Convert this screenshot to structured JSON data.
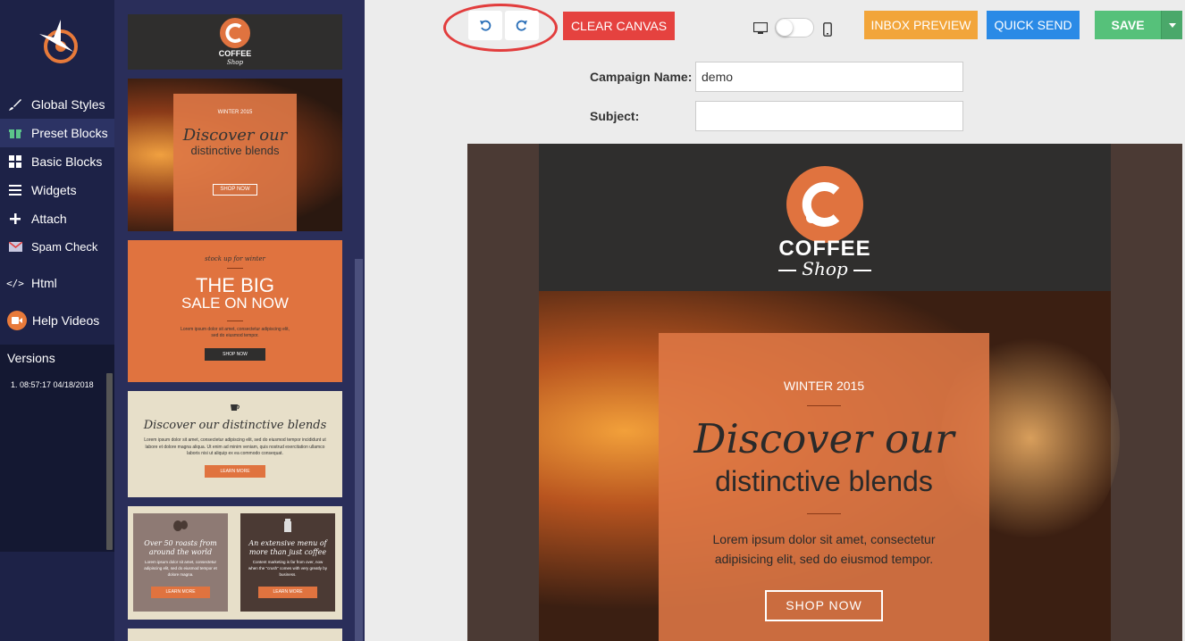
{
  "nav": {
    "items": [
      {
        "label": "Global Styles",
        "icon": "brush-icon"
      },
      {
        "label": "Preset Blocks",
        "icon": "gift-icon"
      },
      {
        "label": "Basic Blocks",
        "icon": "grid-icon"
      },
      {
        "label": "Widgets",
        "icon": "list-icon"
      },
      {
        "label": "Attach",
        "icon": "plus-icon"
      },
      {
        "label": "Spam Check",
        "icon": "mail-icon"
      },
      {
        "label": "Html",
        "icon": "code-icon"
      },
      {
        "label": "Help Videos",
        "icon": "video-icon"
      }
    ],
    "versions_label": "Versions",
    "versions": [
      "1. 08:57:17 04/18/2018"
    ]
  },
  "blocks": {
    "b1": {
      "brand": "COFFEE",
      "sub": "Shop"
    },
    "b2": {
      "eyebrow": "WINTER 2015",
      "title": "Discover our",
      "subtitle": "distinctive blends",
      "button": "SHOP NOW"
    },
    "b3": {
      "eyebrow": "stock up for winter",
      "title": "THE BIG",
      "subtitle": "SALE ON NOW",
      "body": "Lorem ipsum dolor sit amet, consectetur adipiscing elit, sed do eiusmod tempor.",
      "button": "SHOP NOW"
    },
    "b4": {
      "title": "Discover our distinctive blends",
      "body": "Lorem ipsum dolor sit amet, consectetur adipiscing elit, sed do eiusmod tempor incididunt ut labore et dolore magna aliqua. Ut enim ad minim veniam, quis nostrud exercitation ullamco laboris nisi ut aliquip ex ea commodo consequat.",
      "button": "LEARN MORE"
    },
    "b5": {
      "left": {
        "title": "Over 50 roasts from around the world",
        "body": "Lorem ipsum dolor sit amet, consectetur adipiscing elit, sed do eiusmod tempor et dolore magna.",
        "button": "LEARN MORE"
      },
      "right": {
        "title": "An extensive menu of more than just coffee",
        "body": "Content marketing is far from over, now when the \"crush\" comes with very greatly by business.",
        "button": "LEARN MORE"
      }
    }
  },
  "toolbar": {
    "clear": "CLEAR CANVAS",
    "inbox": "INBOX PREVIEW",
    "quick": "QUICK SEND",
    "save": "SAVE"
  },
  "form": {
    "campaign_label": "Campaign Name:",
    "campaign_value": "demo",
    "subject_label": "Subject:",
    "subject_value": ""
  },
  "email": {
    "brand": "COFFEE",
    "sub": "Shop",
    "eyebrow": "WINTER 2015",
    "title": "Discover our",
    "subtitle": "distinctive blends",
    "body": "Lorem ipsum dolor sit amet, consectetur adipisicing elit, sed do eiusmod tempor.",
    "button": "SHOP NOW"
  },
  "colors": {
    "nav_bg": "#1d2247",
    "clear": "#e5423f",
    "inbox": "#f2a53a",
    "quick": "#2a8ae6",
    "save": "#56c17a",
    "accent": "#e0733f"
  }
}
